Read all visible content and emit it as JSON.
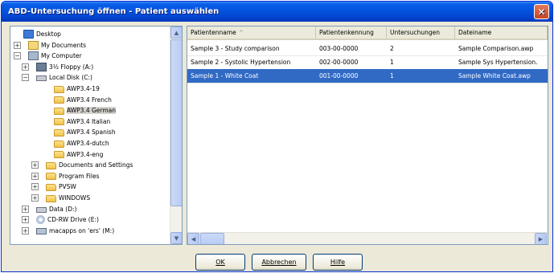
{
  "window": {
    "title": "ABD-Untersuchung öffnen - Patient auswählen",
    "close_label": "✕"
  },
  "tree": {
    "items": [
      {
        "label": "Desktop",
        "icon": "desktop-icon",
        "expander": ""
      },
      {
        "label": "My Documents",
        "icon": "documents-icon",
        "expander": "+"
      },
      {
        "label": "My Computer",
        "icon": "computer-icon",
        "expander": "−"
      },
      {
        "label": "3½ Floppy (A:)",
        "icon": "floppy-icon",
        "expander": "+"
      },
      {
        "label": "Local Disk (C:)",
        "icon": "drive-icon",
        "expander": "−"
      },
      {
        "label": "AWP3.4-19",
        "icon": "folder-icon",
        "expander": ""
      },
      {
        "label": "AWP3.4 French",
        "icon": "folder-icon",
        "expander": ""
      },
      {
        "label": "AWP3.4 German",
        "icon": "folder-icon",
        "expander": ""
      },
      {
        "label": "AWP3.4 Italian",
        "icon": "folder-icon",
        "expander": ""
      },
      {
        "label": "AWP3.4 Spanish",
        "icon": "folder-icon",
        "expander": ""
      },
      {
        "label": "AWP3.4-dutch",
        "icon": "folder-icon",
        "expander": ""
      },
      {
        "label": "AWP3.4-eng",
        "icon": "folder-icon",
        "expander": ""
      },
      {
        "label": "Documents and Settings",
        "icon": "folder-icon",
        "expander": "+"
      },
      {
        "label": "Program Files",
        "icon": "folder-icon",
        "expander": "+"
      },
      {
        "label": "PVSW",
        "icon": "folder-icon",
        "expander": "+"
      },
      {
        "label": "WINDOWS",
        "icon": "folder-icon",
        "expander": "+"
      },
      {
        "label": "Data (D:)",
        "icon": "drive-icon",
        "expander": "+"
      },
      {
        "label": "CD-RW Drive (E:)",
        "icon": "cd-icon",
        "expander": "+"
      },
      {
        "label": "macapps on 'ers' (M:)",
        "icon": "network-drive-icon",
        "expander": "+"
      }
    ],
    "selected_index": 7
  },
  "list": {
    "columns": [
      "Patientenname",
      "Patientenkennung",
      "Untersuchungen",
      "Dateiname"
    ],
    "rows": [
      {
        "name": "Sample 3 - Study comparison",
        "id": "003-00-0000",
        "count": "2",
        "file": "Sample Comparison.awp"
      },
      {
        "name": "Sample 2 - Systolic Hypertension",
        "id": "002-00-0000",
        "count": "1",
        "file": "Sample Sys Hypertension."
      },
      {
        "name": "Sample 1 - White Coat",
        "id": "001-00-0000",
        "count": "1",
        "file": "Sample White Coat.awp"
      }
    ],
    "selected_index": 2
  },
  "buttons": {
    "ok": "OK",
    "cancel": "Abbrechen",
    "help": "Hilfe"
  },
  "colors": {
    "titlebar": "#0453df",
    "selection": "#316ac5"
  }
}
